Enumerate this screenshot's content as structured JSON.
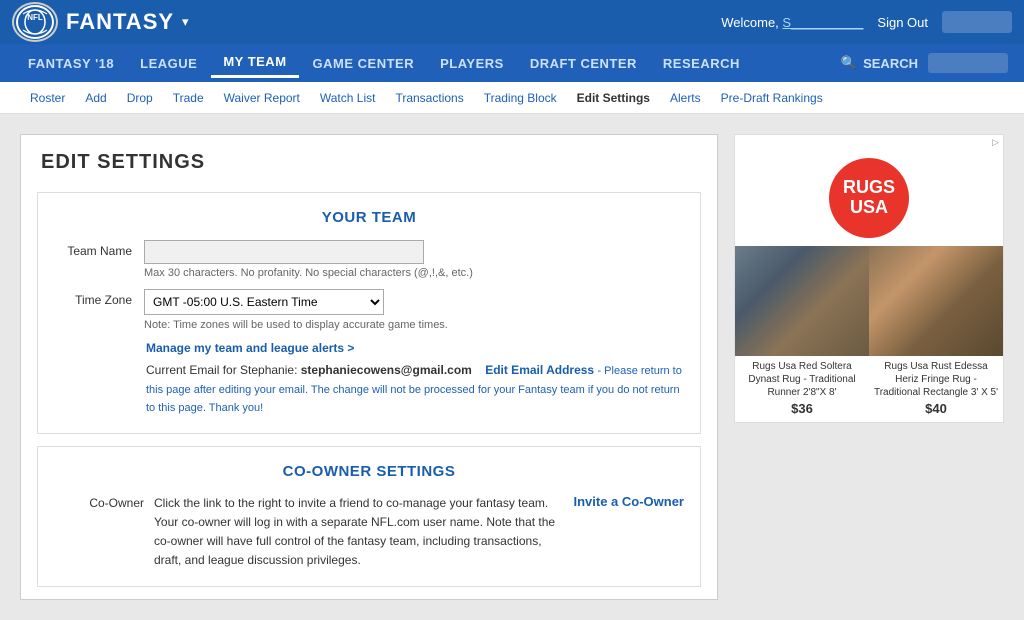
{
  "topBar": {
    "fantasyLabel": "FANTASY",
    "welcomeText": "Welcome,",
    "welcomeName": "S__________",
    "signOutLabel": "Sign Out"
  },
  "nav": {
    "items": [
      {
        "id": "fantasy18",
        "label": "FANTASY '18"
      },
      {
        "id": "league",
        "label": "LEAGUE"
      },
      {
        "id": "myteam",
        "label": "MY TEAM",
        "active": true
      },
      {
        "id": "gamecenter",
        "label": "GAME CENTER"
      },
      {
        "id": "players",
        "label": "PLAYERS"
      },
      {
        "id": "draftcenter",
        "label": "DRAFT CENTER"
      },
      {
        "id": "research",
        "label": "RESEARCH"
      }
    ],
    "searchLabel": "SEARCH"
  },
  "subNav": {
    "items": [
      {
        "id": "roster",
        "label": "Roster"
      },
      {
        "id": "add",
        "label": "Add"
      },
      {
        "id": "drop",
        "label": "Drop"
      },
      {
        "id": "trade",
        "label": "Trade"
      },
      {
        "id": "waiverreport",
        "label": "Waiver Report"
      },
      {
        "id": "watchlist",
        "label": "Watch List"
      },
      {
        "id": "transactions",
        "label": "Transactions"
      },
      {
        "id": "tradingblock",
        "label": "Trading Block"
      },
      {
        "id": "editsettings",
        "label": "Edit Settings",
        "active": true
      },
      {
        "id": "alerts",
        "label": "Alerts"
      },
      {
        "id": "predraftrankings",
        "label": "Pre-Draft Rankings"
      }
    ]
  },
  "pageTitle": "EDIT SETTINGS",
  "yourTeamSection": {
    "title": "YOUR TEAM",
    "teamNameLabel": "Team Name",
    "teamNameValue": "",
    "teamNameHint": "Max 30 characters. No profanity. No special characters (@,!,&, etc.)",
    "timeZoneLabel": "Time Zone",
    "timeZoneValue": "GMT -05:00 U.S. Eastern Time",
    "timeZoneHint": "Note: Time zones will be used to display accurate game times.",
    "manageAlertsLink": "Manage my team and league alerts >",
    "emailPrefix": "Current Email for Stephanie:",
    "emailAddress": "stephaniecowens@gmail.com",
    "editEmailLink": "Edit Email Address",
    "editEmailNote": "- Please return to this page after editing your email. The change will not be processed for your Fantasy team if you do not return to this page. Thank you!"
  },
  "coOwnerSection": {
    "title": "CO-OWNER SETTINGS",
    "coOwnerLabel": "Co-Owner",
    "coOwnerText": "Click the link to the right to invite a friend to co-manage your fantasy team. Your co-owner will log in with a separate NFL.com user name. Note that the co-owner will have full control of the fantasy team, including transactions, draft, and league discussion privileges.",
    "inviteLink": "Invite a Co-Owner"
  },
  "ad": {
    "adLabel": "▷",
    "rugsBrand": "RUGS\nUSA",
    "items": [
      {
        "caption": "Rugs Usa Red Soltera Dynast Rug - Traditional Runner 2'8\"X 8'",
        "price": "$36"
      },
      {
        "caption": "Rugs Usa Rust Edessa Heriz Fringe Rug - Traditional Rectangle 3' X 5'",
        "price": "$40"
      }
    ]
  }
}
